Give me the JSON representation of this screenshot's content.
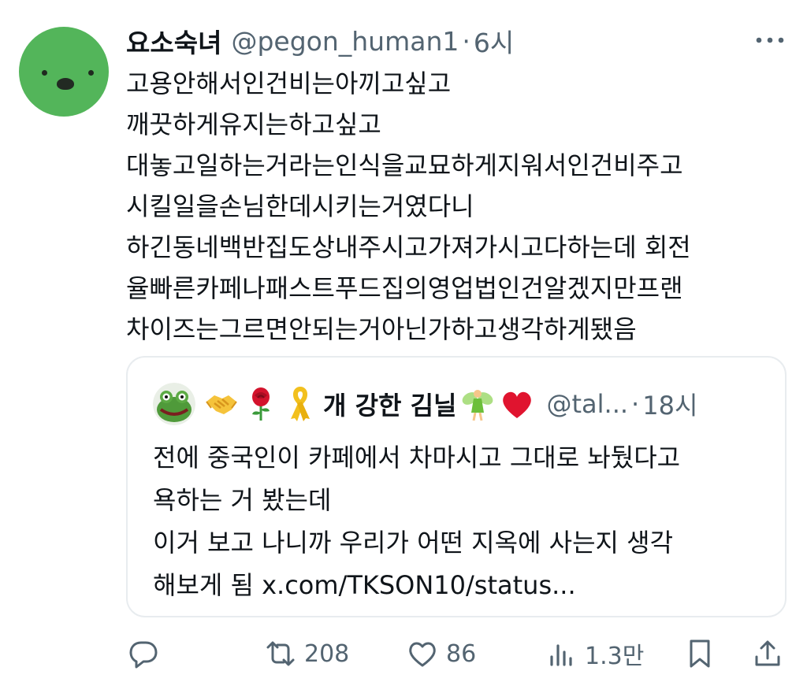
{
  "tweet": {
    "author": {
      "display_name": "요소숙녀",
      "handle": "@pegon_human1",
      "separator": "·",
      "time": "6시"
    },
    "text_lines": [
      "고용안해서인건비는아끼고싶고",
      "깨끗하게유지는하고싶고",
      "대놓고일하는거라는인식을교묘하게지워서인건비주고",
      "시킬일을손님한데시키는거였다니",
      "하긴동네백반집도상내주시고가져가시고다하는데 회전",
      "율빠른카페나패스트푸드집의영업법인건알겠지만프랜",
      "차이즈는그르면안되는거아닌가하고생각하게됐음"
    ],
    "more_icon": "more-horizontal-icon"
  },
  "quote": {
    "author": {
      "display_name": "개 강한 김닐",
      "handle": "@tal...",
      "separator": "·",
      "time": "18시"
    },
    "emojis": [
      "handshake",
      "rose",
      "yellow-ribbon",
      "fairy",
      "red-heart"
    ],
    "text_lines": [
      "전에 중국인이 카페에서 차마시고 그대로 놔뒀다고",
      "욕하는 거 봤는데",
      "이거 보고 나니까 우리가 어떤 지옥에 사는지 생각",
      "해보게 됨 x.com/TKSON10/status..."
    ]
  },
  "actions": {
    "reply": {
      "icon": "reply-icon",
      "count": ""
    },
    "retweet": {
      "icon": "retweet-icon",
      "count": "208"
    },
    "like": {
      "icon": "heart-icon",
      "count": "86"
    },
    "views": {
      "icon": "views-icon",
      "count": "1.3만"
    },
    "bookmark": {
      "icon": "bookmark-icon",
      "count": ""
    },
    "share": {
      "icon": "share-icon",
      "count": ""
    }
  },
  "colors": {
    "text": "#0f1419",
    "secondary": "#536471",
    "border": "#e8ecef",
    "avatar_green": "#53b55a",
    "heart_red": "#e0142f"
  }
}
